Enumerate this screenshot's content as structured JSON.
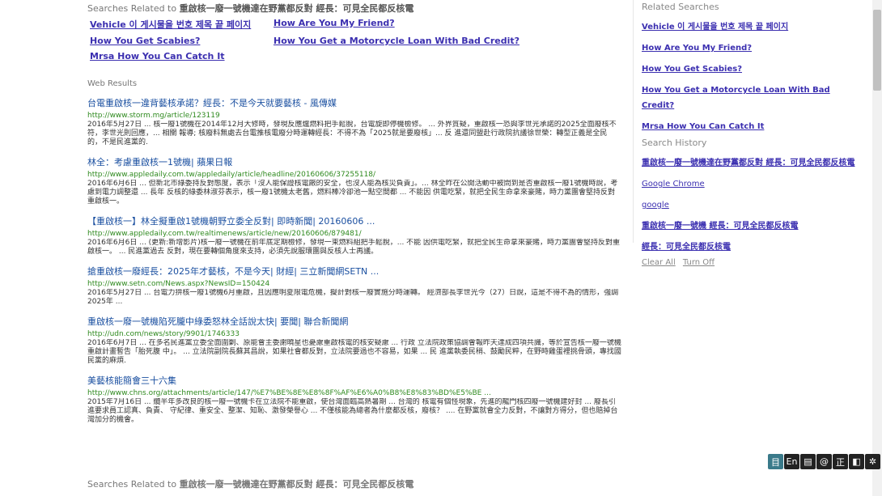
{
  "searches_related": {
    "prefix": "Searches Related to",
    "query": "重啟核一廢一號機達在野黨都反對 經長：可見全民都反核電",
    "links": [
      "Vehicle 이 게시물을 번호 제목 끝 페이지",
      "How Are You My Friend?",
      "How You Get Scabies?",
      "How You Get a Motorcycle Loan With Bad Credit?",
      "Mrsa How You Can Catch It"
    ]
  },
  "web_results_label": "Web Results",
  "results": [
    {
      "title": "台電重啟核一違背藝核承諾？經長：不是今天就要藝核 - 風傳媒",
      "url": "http://www.storm.mg/article/123119",
      "snippet": "2016年5月27日 ... 核一廢1號機在2014年12月大修時，發現反應爐燃料把手鬆脫，台電旋即停機檢修。 ... 外界質疑，重啟核一恐與李世光承諾的2025全面廢核不符，李世光則回應，... 相關 報導; 核廢料無處去台電推核電廢分時運轉經長：不得不為「2025就是要廢核」... 反 進還同盟赴行政院抗議徐世榮：轉型正義是全民的，不是民進黨的."
    },
    {
      "title": "林全：考慮重啟核一1號機| 蘋果日報",
      "url": "http://www.appledaily.com.tw/appledaily/article/headline/20160606/37255118/",
      "snippet": "2016年6月6日 ... 但新北市綠委持反對態度，表示「沒人能保證核電廠的安全，也沒人能為核災負責」。... 林全昨在公開活動中被問到是否重啟核一廢1號機時說，考慮到電力調整還 ... 長年 反核的綠委林淑芬表示，核一廢1號機太老舊，燃料棒冷卻池一點空間都 ... 不能因 供電吃緊，就把全民生命拿來豪賭，時力黨團會堅持反對重啟核一。"
    },
    {
      "title": "【重啟核一】林全擬重啟1號機朝野立委全反對| 即時新聞| 20160606 ...",
      "url": "http://www.appledaily.com.tw/realtimenews/article/new/20160606/879481/",
      "snippet": "2016年6月6日 ... (更新:新增影片)核一廢一號機在前年底定期檢修，發現一束燃料組把手鬆脫，... 不能 因供電吃緊，就把全民生命拿來豪賭，時力黨團會堅持反對重啟核一。 ... 民進黨過去 反對，現在要轉個角度來支持，必須先說服環團與反核人士再議。"
    },
    {
      "title": "搶重啟核一廢經長：2025年才藝核，不是今天| 財經| 三立新聞網SETN ...",
      "url": "http://www.setn.com/News.aspx?NewsID=150424",
      "snippet": "2016年5月27日 ... 台電力拚核一廢1號機6月重啟，且因應明夏限電危機，擬計對核一廢實施分時運轉。 經濟部長李世光今（27）日說，這是不得不為的情形，強調2025年 ..."
    },
    {
      "title": "重啟核一廢一號機陷死朧中綠委怒林全話說太快| 要聞| 聯合新聞網",
      "url": "http://udn.com/news/story/9901/1746333",
      "snippet": "2016年6月7日 ... 在多名民進黨立委全面圍剿、原能會主委謝曉星也憂慮重啟核電的核安疑慮 ... 行政 立法院政策協調會報昨天達成四項共識，等於宣告核一廢一號機重啟計畫暫告「胎死腹 中」。 ... 立法院副院長蘇其昌說，如果社會都反對，立法院要過也不容易，如果 ... 民 進黨執委民稍、鼓勵民粹，在野時雞蛋裡挑骨頭，專找國民黨的麻煩."
    },
    {
      "title": "美藝核能簡會三十六集",
      "url": "http://www.chns.org/attachments/article/147/%E7%BE%8E%E8%8F%AF%E6%A0%B8%E8%83%BD%E5%BE ...",
      "snippet": "2015年7月16日 ... 纜半年多改良的核一廢一號機卡在立法院不能重啟，使台灣面臨高熱暑期 ... 台灣的 核電有個怪現象，先進的龍門核四廢一號機建好封 ... 廢長引進要求員工認真、負責、 守紀律、重安全、整潔、知恥、激發榮譽心 ... 不僅核能為總者為什麼都反核，廢核？ .... 在野黨就會全力反對，不讓對方得分，但也賠掉台灣加分的機會。"
    }
  ],
  "sidebar": {
    "related_searches_label": "Related Searches",
    "related": [
      "Vehicle 이 게시물을 번호 제목 끝 페이지",
      "How Are You My Friend?",
      "How You Get Scabies?",
      "How You Get a Motorcycle Loan With Bad Credit?",
      "Mrsa How You Can Catch It"
    ],
    "history_label": "Search History",
    "history": [
      "重啟核一廢一號機達在野黨都反對 經長：可見全民都反核電",
      "Google Chrome",
      "google",
      "重啟核一廢一號機 經長：可見全民都反核電",
      "經長：可見全民都反核電"
    ],
    "clear_all": "Clear All",
    "turn_off": "Turn Off"
  },
  "toolbar": [
    "目",
    "En",
    "▤",
    "@",
    "正",
    "◧",
    "✲"
  ]
}
